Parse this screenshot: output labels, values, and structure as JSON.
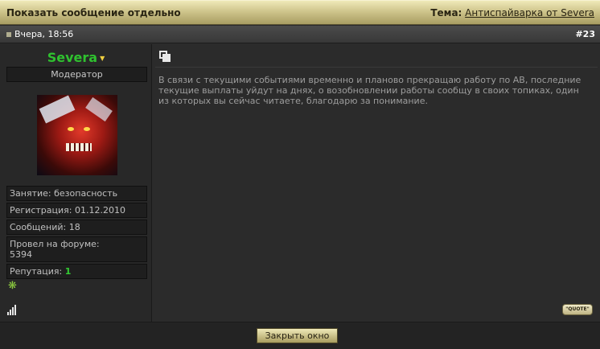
{
  "header": {
    "title": "Показать сообщение отдельно",
    "topic_label": "Тема:",
    "topic_link": "Антиспайварка от Severa"
  },
  "post": {
    "date": "Вчера, 18:56",
    "number": "#23",
    "message": "В связи с текущими событиями временно и планово прекращаю работу по AB, последние текущие выплаты уйдут на днях, о возобновлении работы сообщу в своих топиках, один из которых вы сейчас читаете, благодарю за понимание.",
    "quote_label": "\"QUOTE\""
  },
  "user": {
    "name": "Severa",
    "rank": "Модератор",
    "occupation": "Занятие: безопасность",
    "registration": "Регистрация: 01.12.2010",
    "messages": "Сообщений: 18",
    "time_label": "Провел на форуме:",
    "time_value": "5394",
    "reputation_label": "Репутация:",
    "reputation_value": "1"
  },
  "footer": {
    "close_label": "Закрыть окно"
  },
  "colors": {
    "username": "#2fc12f",
    "reputation": "#33cc33",
    "header_gold": "#cfc58c"
  },
  "icons": [
    "chevron-down-icon",
    "copy-icon",
    "reputation-icon",
    "signal-icon"
  ]
}
